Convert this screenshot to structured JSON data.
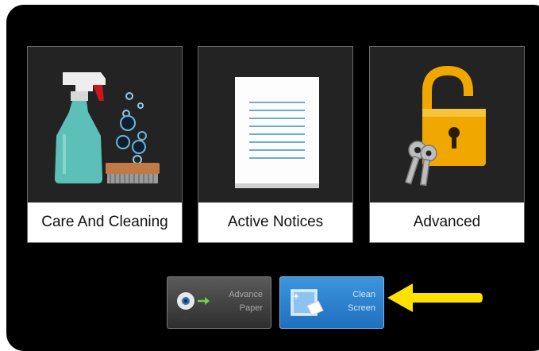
{
  "tiles": [
    {
      "label": "Care And Cleaning",
      "icon": "spray-bottle-icon"
    },
    {
      "label": "Active Notices",
      "icon": "document-icon"
    },
    {
      "label": "Advanced",
      "icon": "padlock-keys-icon"
    }
  ],
  "buttons": {
    "advance_paper": {
      "line1": "Advance",
      "line2": "Paper",
      "icon": "paper-roll-icon"
    },
    "clean_screen": {
      "line1": "Clean",
      "line2": "Screen",
      "icon": "clean-screen-icon"
    }
  },
  "annotation": {
    "icon": "arrow-left-icon",
    "color": "#ffe100"
  },
  "colors": {
    "screen_bg": "#000000",
    "tile_bg": "#232323",
    "clean_button": "#2a82cf",
    "advance_button": "#454545",
    "padlock": "#f0a800",
    "bottle": "#5cc0b8"
  }
}
